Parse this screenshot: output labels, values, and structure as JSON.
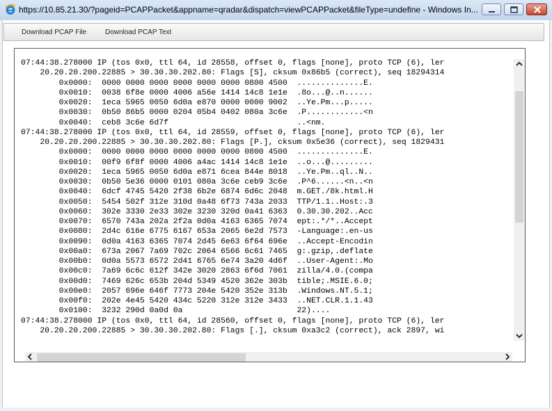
{
  "window": {
    "title": "https://10.85.21.30/?pageid=PCAPPacket&appname=qradar&dispatch=viewPCAPPacket&fileType=undefine - Windows In..."
  },
  "icons": {
    "browser": "internet-explorer-icon",
    "minimize": "minimize-icon",
    "maximize": "maximize-icon",
    "close": "close-icon",
    "scroll_up": "chevron-up-icon",
    "scroll_down": "chevron-down-icon",
    "scroll_left": "chevron-left-icon",
    "scroll_right": "chevron-right-icon"
  },
  "toolbar": {
    "download_pcap_file": "Download PCAP File",
    "download_pcap_text": "Download PCAP Text"
  },
  "packet_view": {
    "text": "07:44:38.278000 IP (tos 0x0, ttl 64, id 28558, offset 0, flags [none], proto TCP (6), ler\n    20.20.20.200.22885 > 30.30.30.202.80: Flags [S], cksum 0x86b5 (correct), seq 18294314\n        0x0000:  0000 0000 0000 0000 0000 0000 0800 4500  ..............E.\n        0x0010:  0038 6f8e 0000 4006 a56e 1414 14c8 1e1e  .8o...@..n......\n        0x0020:  1eca 5965 0050 6d0a e870 0000 0000 9002  ..Ye.Pm...p.....\n        0x0030:  0b50 86b5 0000 0204 05b4 0402 080a 3c6e  .P............<n\n        0x0040:  ceb8 3c6e 6d7f                           ..<nm.\n07:44:38.278000 IP (tos 0x0, ttl 64, id 28559, offset 0, flags [none], proto TCP (6), ler\n    20.20.20.200.22885 > 30.30.30.202.80: Flags [P.], cksum 0x5e36 (correct), seq 1829431\n        0x0000:  0000 0000 0000 0000 0000 0000 0800 4500  ..............E.\n        0x0010:  00f9 6f8f 0000 4006 a4ac 1414 14c8 1e1e  ..o...@.........\n        0x0020:  1eca 5965 0050 6d0a e871 6cea 844e 8018  ..Ye.Pm..ql..N..\n        0x0030:  0b50 5e36 0000 0101 080a 3c6e ceb9 3c6e  .P^6......<n..<n\n        0x0040:  6dcf 4745 5420 2f38 6b2e 6874 6d6c 2048  m.GET./8k.html.H\n        0x0050:  5454 502f 312e 310d 0a48 6f73 743a 2033  TTP/1.1..Host:.3\n        0x0060:  302e 3330 2e33 302e 3230 320d 0a41 6363  0.30.30.202..Acc\n        0x0070:  6570 743a 202a 2f2a 0d0a 4163 6365 7074  ept:.*/*..Accept\n        0x0080:  2d4c 616e 6775 6167 653a 2065 6e2d 7573  -Language:.en-us\n        0x0090:  0d0a 4163 6365 7074 2d45 6e63 6f64 696e  ..Accept-Encodin\n        0x00a0:  673a 2067 7a69 702c 2064 6566 6c61 7465  g:.gzip,.deflate\n        0x00b0:  0d0a 5573 6572 2d41 6765 6e74 3a20 4d6f  ..User-Agent:.Mo\n        0x00c0:  7a69 6c6c 612f 342e 3020 2863 6f6d 7061  zilla/4.0.(compa\n        0x00d0:  7469 626c 653b 204d 5349 4520 362e 303b  tible;.MSIE.6.0;\n        0x00e0:  2057 696e 646f 7773 204e 5420 352e 313b  .Windows.NT.5.1;\n        0x00f0:  202e 4e45 5420 434c 5220 312e 312e 3433  ..NET.CLR.1.1.43\n        0x0100:  3232 290d 0a0d 0a                        22)....\n07:44:38.278000 IP (tos 0x0, ttl 64, id 28560, offset 0, flags [none], proto TCP (6), ler\n    20.20.20.200.22885 > 30.30.30.202.80: Flags [.], cksum 0xa3c2 (correct), ack 2897, wi"
  }
}
